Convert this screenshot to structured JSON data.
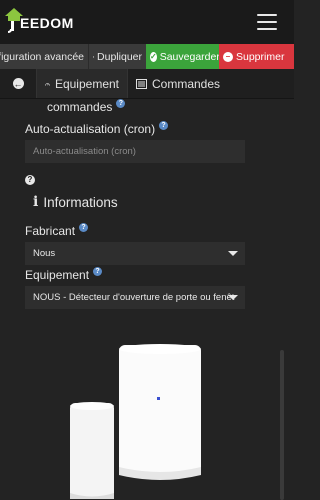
{
  "app": {
    "brand": "EEDOM"
  },
  "actions": {
    "advanced_label": "Configuration avancée",
    "duplicate_label": "Dupliquer",
    "save_label": "Sauvegarder",
    "delete_label": "Supprimer",
    "colors": {
      "save": "#3ba43b",
      "delete": "#d9363e"
    }
  },
  "tabs": {
    "items": [
      {
        "icon": "arrow-left-icon",
        "label": ""
      },
      {
        "icon": "gauge-icon",
        "label": "Equipement",
        "active": true
      },
      {
        "icon": "list-icon",
        "label": "Commandes"
      }
    ]
  },
  "form": {
    "commandes_label": "commandes",
    "auto_refresh_label": "Auto-actualisation (cron)",
    "auto_refresh_placeholder": "Auto-actualisation (cron)",
    "info_section_title": "Informations",
    "manufacturer_label": "Fabricant",
    "manufacturer_value": "Nous",
    "equipment_label": "Equipement",
    "equipment_value": "NOUS - Détecteur d'ouverture de porte ou fenêt"
  }
}
